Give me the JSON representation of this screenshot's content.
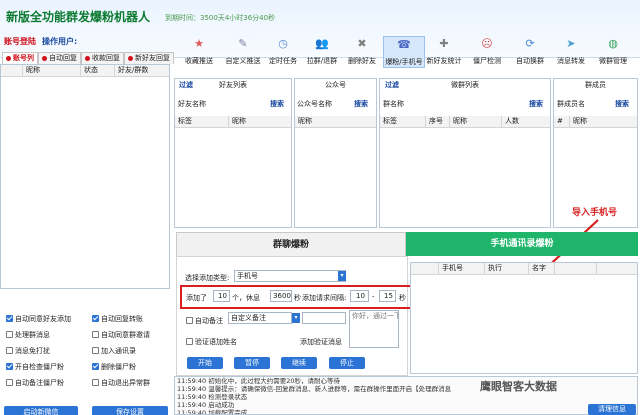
{
  "app": {
    "title": "新版全功能群发爆粉机器人",
    "expiry": "到期时间：3500天4小时36分40秒",
    "account_login": "账号登陆",
    "operator": "操作用户:"
  },
  "toolbar": [
    {
      "label": "收藏推送",
      "icon": "star-icon",
      "color": "#e05a5a",
      "glyph": "★"
    },
    {
      "label": "自定义推送",
      "icon": "settings-icon",
      "color": "#7a7a9a",
      "glyph": "✎"
    },
    {
      "label": "定时任务",
      "icon": "clock-icon",
      "color": "#5a8ad0",
      "glyph": "◷"
    },
    {
      "label": "拉群/退群",
      "icon": "group-icon",
      "color": "#808080",
      "glyph": "👥"
    },
    {
      "label": "删除好友",
      "icon": "delete-friend-icon",
      "color": "#808080",
      "glyph": "✖"
    },
    {
      "label": "爆粉/手机号",
      "icon": "contact-card-icon",
      "color": "#4a66c0",
      "glyph": "☎"
    },
    {
      "label": "新好友统计",
      "icon": "new-friend-icon",
      "color": "#808080",
      "glyph": "✚"
    },
    {
      "label": "僵尸检测",
      "icon": "face-icon",
      "color": "#d04a4a",
      "glyph": "☹"
    },
    {
      "label": "自动换群",
      "icon": "refresh-icon",
      "color": "#4a8ad0",
      "glyph": "⟳"
    },
    {
      "label": "消息转发",
      "icon": "forward-icon",
      "color": "#4aa0d0",
      "glyph": "➤"
    },
    {
      "label": "微群管理",
      "icon": "globe-icon",
      "color": "#3aa05a",
      "glyph": "◍"
    }
  ],
  "left": {
    "tabs": [
      "账号列",
      "自动回复",
      "收款回复",
      "新好友回复"
    ],
    "columns": [
      "",
      "昵称",
      "状态",
      "好友/群数"
    ],
    "options": [
      {
        "label": "自动同意好友添加",
        "checked": true
      },
      {
        "label": "自动回复转账",
        "checked": true
      },
      {
        "label": "处理群消息",
        "checked": false
      },
      {
        "label": "自动同意群邀请",
        "checked": false
      },
      {
        "label": "消息免打扰",
        "checked": false
      },
      {
        "label": "加入通讯录",
        "checked": false
      },
      {
        "label": "开自检查僵尸粉",
        "checked": true
      },
      {
        "label": "删除僵尸粉",
        "checked": true
      },
      {
        "label": "自动备注僵尸粉",
        "checked": false
      },
      {
        "label": "自动退出异常群",
        "checked": false
      }
    ],
    "start_button": "启动新微信",
    "save_button": "保存设置"
  },
  "friends": {
    "title": "好友列表",
    "filter": "过滤",
    "name_label": "好友名称",
    "search": "搜索",
    "columns": [
      "标签",
      "昵称"
    ]
  },
  "officials": {
    "title": "公众号",
    "name_label": "公众号名称",
    "search": "搜索",
    "columns": [
      "昵称"
    ]
  },
  "groups": {
    "title": "微群列表",
    "filter": "过滤",
    "name_label": "群名称",
    "search": "搜索",
    "columns": [
      "标签",
      "序号",
      "昵称",
      "人数"
    ]
  },
  "members": {
    "title": "群成员",
    "name_label": "群成员名",
    "search": "搜索",
    "columns": [
      "#",
      "昵称"
    ]
  },
  "annotation": {
    "text": "导入手机号",
    "color": "#d81e1e"
  },
  "tabs": {
    "group_fans": "群聊爆粉",
    "phone_fans": "手机通讯录爆粉"
  },
  "form": {
    "type_label": "选择添加类型:",
    "type_value": "手机号",
    "add_label": "添加了",
    "add_count": "10",
    "add_unit": "个，休息",
    "rest_value": "3600",
    "rest_unit": "秒",
    "interval_label": "添加请求间隔:",
    "interval_min": "10",
    "interval_sep": "-",
    "interval_max": "15",
    "interval_unit": "秒",
    "auto_remark_label": "自动备注",
    "remark_value": "自定义备注",
    "greeting_label": "验证语加姓名",
    "verify_label": "添加验证消息",
    "verify_placeholder": "你好，通过一下",
    "buttons": [
      "开始",
      "暂停",
      "继续",
      "停止"
    ]
  },
  "phone_table": {
    "columns": [
      "",
      "手机号",
      "执行",
      "名字",
      "",
      ""
    ]
  },
  "log": {
    "lines": [
      "11:59:40 初始化中，此过程大约需要20秒，请耐心等待",
      "11:59:40 温馨提示：请确保微信-回复群消息、新人进群等，需在群操作里面开启【处理群消息",
      "11:59:40 检测登录状态",
      "11:59:40 启动成功",
      "11:59:40 加载配置完成",
      "11:59:45 启动新用户群",
      "11:59:45 已导入0个数据"
    ],
    "clear_button": "清理信息"
  },
  "watermark": "鹰眼智客大数据"
}
